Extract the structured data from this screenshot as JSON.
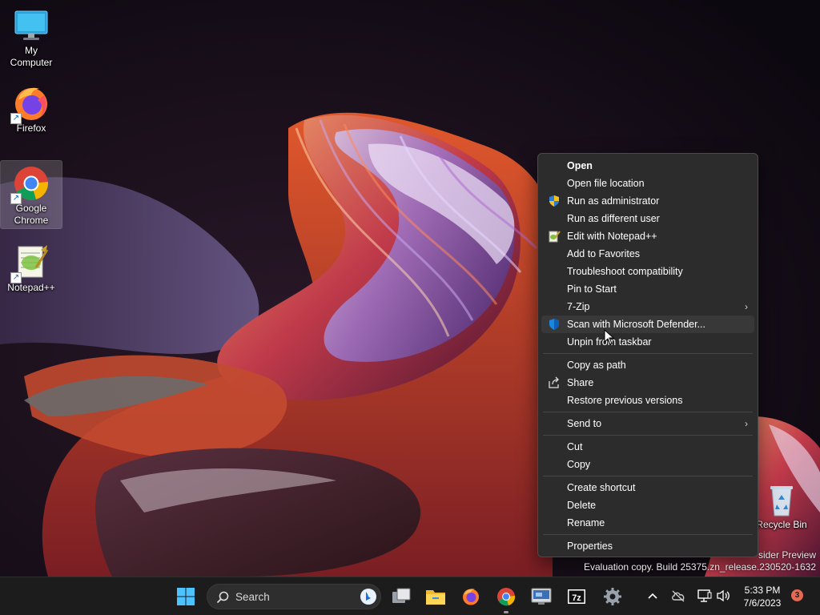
{
  "desktop": {
    "icons": [
      {
        "label": "My Computer"
      },
      {
        "label": "Firefox"
      },
      {
        "label": "Google Chrome"
      },
      {
        "label": "Notepad++"
      },
      {
        "label": "Recycle Bin"
      }
    ]
  },
  "context_menu": {
    "items": [
      {
        "label": "Open"
      },
      {
        "label": "Open file location"
      },
      {
        "label": "Run as administrator",
        "icon": "uac-shield-icon"
      },
      {
        "label": "Run as different user"
      },
      {
        "label": "Edit with Notepad++",
        "icon": "notepad-plus-plus-icon"
      },
      {
        "label": "Add to Favorites"
      },
      {
        "label": "Troubleshoot compatibility"
      },
      {
        "label": "Pin to Start"
      },
      {
        "label": "7-Zip"
      },
      {
        "label": "Scan with Microsoft Defender...",
        "icon": "defender-shield-icon"
      },
      {
        "label": "Unpin from taskbar"
      },
      {
        "label": "Copy as path"
      },
      {
        "label": "Share",
        "icon": "share-icon"
      },
      {
        "label": "Restore previous versions"
      },
      {
        "label": "Send to"
      },
      {
        "label": "Cut"
      },
      {
        "label": "Copy"
      },
      {
        "label": "Create shortcut"
      },
      {
        "label": "Delete"
      },
      {
        "label": "Rename"
      },
      {
        "label": "Properties"
      }
    ]
  },
  "watermark": {
    "line1": "sider Preview",
    "line2": "Evaluation copy. Build 25375.zn_release.230520-1632"
  },
  "taskbar": {
    "search_placeholder": "Search",
    "apps": [
      "start-icon",
      "task-view-icon",
      "file-explorer-icon",
      "firefox-icon",
      "chrome-icon",
      "remote-desktop-icon",
      "7zip-icon",
      "settings-icon"
    ],
    "clock": {
      "time": "5:33 PM",
      "date": "7/6/2023"
    },
    "notification_count": "3"
  },
  "colors": {
    "menu_bg": "#2c2c2c",
    "taskbar_bg": "#1c1c1c",
    "accent_blue": "#0078d4",
    "badge": "#e26b55"
  }
}
